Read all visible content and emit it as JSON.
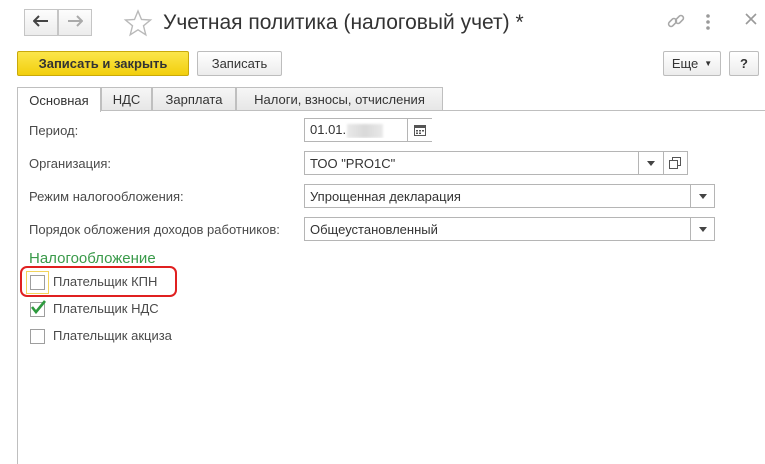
{
  "window": {
    "title": "Учетная политика (налоговый учет) *"
  },
  "icons": {
    "back": "arrow-left-icon",
    "forward": "arrow-right-icon",
    "favorite": "star-icon",
    "link": "link-icon",
    "more": "more-vertical-icon",
    "close": "close-icon",
    "calendar": "calendar-icon",
    "dropdown": "chevron-down-icon",
    "open": "open-form-icon"
  },
  "toolbar": {
    "save_close_label": "Записать и закрыть",
    "save_label": "Записать",
    "more_label": "Еще",
    "help_label": "?"
  },
  "tabs": [
    {
      "label": "Основная",
      "active": true
    },
    {
      "label": "НДС",
      "active": false
    },
    {
      "label": "Зарплата",
      "active": false
    },
    {
      "label": "Налоги, взносы, отчисления",
      "active": false
    }
  ],
  "form": {
    "period_label": "Период:",
    "period_value": "01.01.",
    "organization_label": "Организация:",
    "organization_value": "ТОО \"PRO1C\"",
    "tax_mode_label": "Режим налогообложения:",
    "tax_mode_value": "Упрощенная декларация",
    "employee_income_label": "Порядок обложения доходов работников:",
    "employee_income_value": "Общеустановленный"
  },
  "taxation": {
    "section_title": "Налогообложение",
    "checkboxes": [
      {
        "label": "Плательщик КПН",
        "checked": false
      },
      {
        "label": "Плательщик НДС",
        "checked": true
      },
      {
        "label": "Плательщик акциза",
        "checked": false
      }
    ]
  },
  "colors": {
    "primary_button": "#f5d51e",
    "section_title": "#3a9a4a",
    "checkmark": "#2e9a3e",
    "highlight": "#e02020"
  }
}
